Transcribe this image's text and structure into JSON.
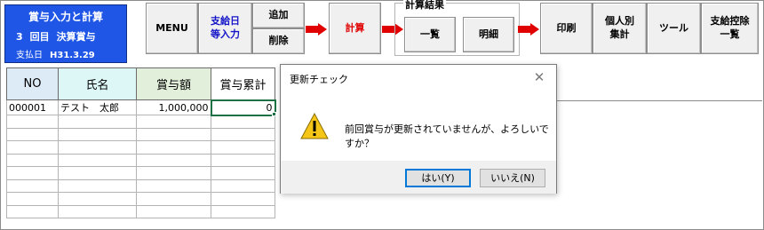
{
  "window": {
    "title_line1": "賞与入力と計算",
    "period_number": "3",
    "period_label": "回目",
    "bonus_name": "決算賞与",
    "pay_date_label": "支払日",
    "pay_date": "H31.3.29"
  },
  "toolbar": {
    "menu": "MENU",
    "pay_date_entry": "支給日\n等入力",
    "add": "追加",
    "delete": "削除",
    "calculate": "計算",
    "results_group": "計算結果",
    "list": "一覧",
    "detail": "明細",
    "print": "印刷",
    "individual_summary": "個人別\n集計",
    "tools": "ツール",
    "deduction_list": "支給控除\n一覧"
  },
  "grid": {
    "headers": {
      "no": "NO",
      "name": "氏名",
      "bonus": "賞与額",
      "cumulative": "賞与累計"
    },
    "rows": [
      {
        "no": "000001",
        "name": "テスト　太郎",
        "bonus": "1,000,000",
        "cumulative": "0"
      }
    ]
  },
  "dialog": {
    "title": "更新チェック",
    "close": "✕",
    "message": "前回賞与が更新されていませんが、よろしいですか？",
    "yes": "はい(Y)",
    "no": "いいえ(N)"
  },
  "colors": {
    "title_bg": "#1f56e6",
    "pay_date_entry_text": "#1414c8",
    "calculate_text": "#e00000",
    "arrow": "#e00000",
    "selection": "#1e7145",
    "dialog_default_border": "#0078d7"
  },
  "icons": {
    "arrow": "right-arrow-icon",
    "warning": "warning-icon"
  }
}
